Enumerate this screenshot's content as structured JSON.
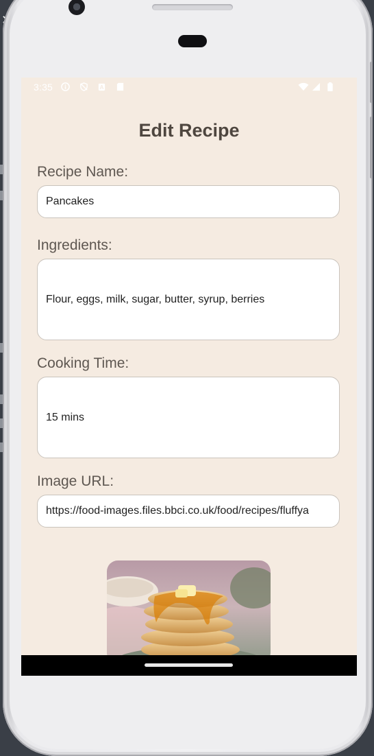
{
  "desktop": {
    "close_glyph": "✕"
  },
  "status_bar": {
    "time": "3:35",
    "icons": [
      "info-icon",
      "no-disturb-icon",
      "sim-alert-icon",
      "sd-card-icon",
      "wifi-icon",
      "cell-signal-icon",
      "battery-icon"
    ]
  },
  "page": {
    "title": "Edit Recipe"
  },
  "form": {
    "recipe_name_label": "Recipe Name:",
    "recipe_name_value": "Pancakes",
    "ingredients_label": "Ingredients:",
    "ingredients_value": "Flour, eggs, milk, sugar, butter, syrup, berries",
    "cooking_time_label": "Cooking Time:",
    "cooking_time_value": "15 mins",
    "image_url_label": "Image URL:",
    "image_url_value": "https://food-images.files.bbci.co.uk/food/recipes/fluffya"
  },
  "preview": {
    "image_subject": "stack of pancakes with syrup and butter"
  },
  "colors": {
    "screen_bg": "#f5ebe1",
    "title": "#4e463f",
    "label": "#5e5751",
    "field_border": "#c9c3bc"
  }
}
